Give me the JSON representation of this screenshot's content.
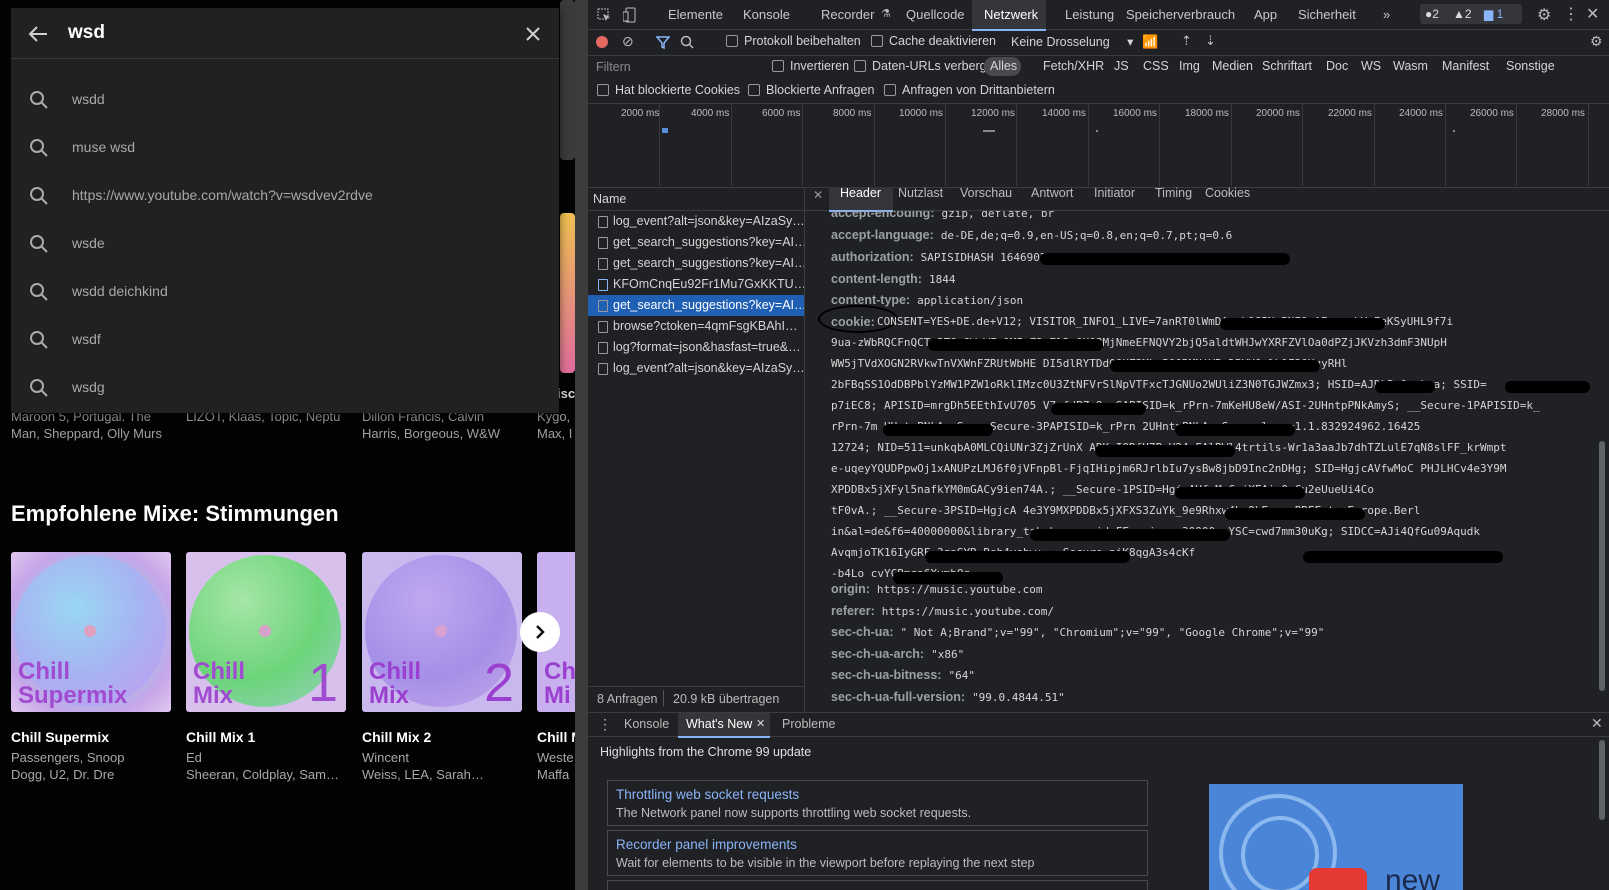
{
  "ytm": {
    "search": {
      "query": "wsd",
      "suggestions": [
        "wsdd",
        "muse wsd",
        "https://www.youtube.com/watch?v=wsdvev2rdve",
        "wsde",
        "wsdd deichkind",
        "wsdf",
        "wsdg"
      ]
    },
    "strip": [
      {
        "line1": "Maroon 5, Portugal. The",
        "line2": "Man, Sheppard, Olly Murs"
      },
      {
        "line1": "LIZOT, Klaas, Topic, Neptu",
        "line2": ""
      },
      {
        "line1": "Dillon Francis, Calvin",
        "line2": "Harris, Borgeous, W&W"
      },
      {
        "line1": "Kygo,",
        "line2": "Max, I"
      }
    ],
    "section_title": "Empfohlene Mixe: Stimmungen",
    "mixes": [
      {
        "art_line1": "Chill",
        "art_line2": "Supermix",
        "art_num": "",
        "title": "Chill Supermix",
        "sub1": "Passengers, Snoop",
        "sub2": "Dogg, U2, Dr. Dre"
      },
      {
        "art_line1": "Chill",
        "art_line2": "Mix",
        "art_num": "1",
        "title": "Chill Mix 1",
        "sub1": "Ed",
        "sub2": "Sheeran, Coldplay, Sam…"
      },
      {
        "art_line1": "Chill",
        "art_line2": "Mix",
        "art_num": "2",
        "title": "Chill Mix 2",
        "sub1": "Wincent",
        "sub2": "Weiss, LEA, Sarah…"
      },
      {
        "art_line1": "Ch",
        "art_line2": "Mi",
        "art_num": "",
        "title": "Chill M",
        "sub1": "Weste",
        "sub2": "Maffa"
      }
    ],
    "partial_text": "isch"
  },
  "devtools": {
    "tabs": [
      "Elemente",
      "Konsole",
      "Recorder",
      "Quellcode",
      "Netzwerk",
      "Leistung",
      "Speicherverbrauch",
      "App",
      "Sicherheit"
    ],
    "active_tab": "Netzwerk",
    "status": {
      "errors": "2",
      "warnings": "2",
      "issues": "1"
    },
    "toolbar": {
      "preserve_log": "Protokoll beibehalten",
      "disable_cache": "Cache deaktivieren",
      "throttling": "Keine Drosselung"
    },
    "filter": {
      "placeholder": "Filtern",
      "invert": "Invertieren",
      "hide_data_urls": "Daten-URLs verbergen",
      "types": [
        "Alles",
        "Fetch/XHR",
        "JS",
        "CSS",
        "Img",
        "Medien",
        "Schriftart",
        "Doc",
        "WS",
        "Wasm",
        "Manifest",
        "Sonstige"
      ],
      "blocked_cookies": "Hat blockierte Cookies",
      "blocked_requests": "Blockierte Anfragen",
      "third_party": "Anfragen von Drittanbietern"
    },
    "timeline_ticks": [
      "2000 ms",
      "4000 ms",
      "6000 ms",
      "8000 ms",
      "10000 ms",
      "12000 ms",
      "14000 ms",
      "16000 ms",
      "18000 ms",
      "20000 ms",
      "22000 ms",
      "24000 ms",
      "26000 ms",
      "28000 ms"
    ],
    "name_header": "Name",
    "requests": [
      "log_event?alt=json&key=AIzaSy…",
      "get_search_suggestions?key=AI…",
      "get_search_suggestions?key=AI…",
      "KFOmCnqEu92Fr1Mu7GxKKTU…",
      "get_search_suggestions?key=AI…",
      "browse?ctoken=4qmFsgKBAhI…",
      "log?format=json&hasfast=true&…",
      "log_event?alt=json&key=AIzaSy…"
    ],
    "selected_request": 4,
    "detail_tabs": [
      "Header",
      "Nutzlast",
      "Vorschau",
      "Antwort",
      "Initiator",
      "Timing",
      "Cookies"
    ],
    "active_detail_tab": "Header",
    "headers": [
      {
        "name": "accept-encoding:",
        "value": "gzip, deflate, br"
      },
      {
        "name": "accept-language:",
        "value": "de-DE,de;q=0.9,en-US;q=0.8,en;q=0.7,pt;q=0.6"
      },
      {
        "name": "authorization:",
        "value": "SAPISIDHASH 164690210                                          f9bd9ac67d"
      },
      {
        "name": "content-length:",
        "value": "1844"
      },
      {
        "name": "content-type:",
        "value": "application/json"
      }
    ],
    "cookie_name": "cookie:",
    "cookie_lines": [
      "CONSENT=YES+DE.de+V12; VISITOR_INFO1_LIVE=7anRT0lWmDA; LOGIN_INFO=AF                       rquLVzFeKSyUHL9f7i",
      "9ua-zWbRQCFnQCT                  3T8z8W-WFcOMIaZ2o7l2:QUQ3MjNmeEFNQVY2bjQ5aldtWHJwYXRFZVlOa0dPZjJKVzh3dmF3NUpH",
      "WW5jTVdXOGN2RVkwTnVXWnFZRUtWbHE                          DI5dlRYTDd0QUZ3Mkp5Q0RMNjVRcDBVY0plb1F2OHgyRHl",
      "2bFBqSS1OdDBPblYzMW1PZW1oRklIMzc0U3ZtNFVrSlNpVTFxcTJGNUo2WUliZ3N0TGJWZmx3; HSID=AJDkR          OruLua; SSID=",
      "p7iEC8; APISID=mrgDh5EEthIvU705                V7cfdPZy9; SAPISID=k_rPrn-7mKeHU8eW/ASI-2UHntpPNkAmyS; __Secure-1PAPISID=k_",
      "rPrn-7m              UHntpPNkAmyS; __Secure-3PAPISID=k_rPrn               2UHntpPNkAmyS; _gcl_au=1.1.832924962.16425",
      "12724; NID=511=unkqbA0MLCQiUNr3ZjZrUnX                  ARKwIORfU7P_V24xFAlRWl4trtils-Wr1a3aaJb7dhTZLulE7qN8slFF_krWmpt",
      "e-uqeyYQUDPpwOj1xANUPzLMJ6f0jVFnpBl-FjqIHipjm6RJrlbIu7ysBw8jbD9Inc2nDHg; SID=HgjcAVfwMoC                   PHJLHCv4e3Y9M",
      "XPDDBx5jXFyl5nafkYM0mGACy9ien74A.; __Secure-1PSID=HgjcAVfwMoC                    jXFAis0uCu2eUueUi4Co",
      "tF0vA.; __Secure-3PSID=HgjcA                     4e3Y9MXPDDBx5jXFXS3ZuYk_9e9Rhxw4hn9hEg.; PREF=tz=Europe.Berl",
      "in&al=de&f6=40000000&library_tab_browse_id=FEmusic_                 =30000; YSC=cwd7mm30uKg; SIDCC=AJi4QfGu09Aqudk",
      "AvqmjoTK16IyGRF                          3qaSYR_Rsh4vebw; __Secure                                     piK8qgA3s4cKf",
      "-b4Lo                  cvYCBmqa6XymbQg"
    ],
    "headers_after": [
      {
        "name": "origin:",
        "value": "https://music.youtube.com"
      },
      {
        "name": "referer:",
        "value": "https://music.youtube.com/"
      },
      {
        "name": "sec-ch-ua:",
        "value": "\" Not A;Brand\";v=\"99\", \"Chromium\";v=\"99\", \"Google Chrome\";v=\"99\""
      },
      {
        "name": "sec-ch-ua-arch:",
        "value": "\"x86\""
      },
      {
        "name": "sec-ch-ua-bitness:",
        "value": "\"64\""
      },
      {
        "name": "sec-ch-ua-full-version:",
        "value": "\"99.0.4844.51\""
      }
    ],
    "summary": {
      "requests": "8 Anfragen",
      "transferred": "20.9 kB übertragen"
    },
    "drawer": {
      "tabs": [
        "Konsole",
        "What's New",
        "Probleme"
      ],
      "active": "What's New",
      "highlight": "Highlights from the Chrome 99 update",
      "cards": [
        {
          "title": "Throttling web socket requests",
          "desc": "The Network panel now supports throttling web socket requests."
        },
        {
          "title": "Recorder panel improvements",
          "desc": "Wait for elements to be visible in the viewport before replaying the next step"
        }
      ],
      "promo_text": "new"
    }
  }
}
